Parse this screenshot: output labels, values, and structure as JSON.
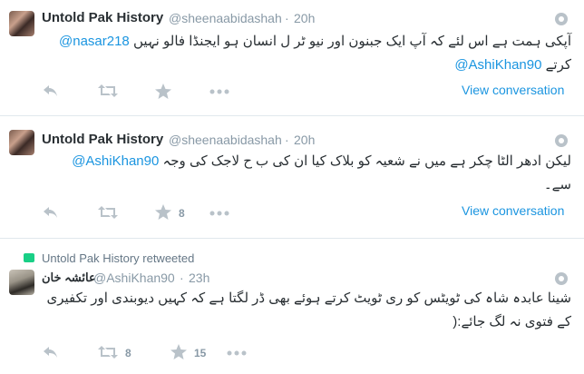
{
  "tweets": [
    {
      "name": "Untold Pak History",
      "handle": "@sheenaabidashah",
      "time": "20h",
      "mention1": "@nasar218",
      "line1": "آپکی ہمت ہے اس لئے کہ آپ ایک جبنون اور نیو ٹر ل انسان ہو ایجنڈا فالو نہیں",
      "line2": "کرتے",
      "mention2": "@AshiKhan90",
      "view": "View conversation",
      "retweets": "",
      "favorites": ""
    },
    {
      "name": "Untold Pak History",
      "handle": "@sheenaabidashah",
      "time": "20h",
      "mention1": "@AshiKhan90",
      "line1": "لیکن ادھر الٹا چکر ہے میں نے شعیہ کو بلاک کیا ان کی ب ح لاجک کی وجہ",
      "line2": "سے۔",
      "view": "View conversation",
      "retweets": "",
      "favorites": "8"
    },
    {
      "retweet_label": "Untold Pak History retweeted",
      "name": "عائشہ خان",
      "handle": "@AshiKhan90",
      "time": "23h",
      "line1": "شینا عابدہ شاہ کی ٹویٹس کو ری ٹویٹ کرتے ہوئے بھی ڈر لگتا ہے کہ کہیں دیوبندی اور تکفیری",
      "line2": "کے فتوی نہ لگ جائے:(",
      "retweets": "8",
      "favorites": "15"
    }
  ],
  "colors": {
    "link": "#1b95e0",
    "muted": "#8899a6",
    "text": "#292f33",
    "retweet": "#19cf86"
  }
}
